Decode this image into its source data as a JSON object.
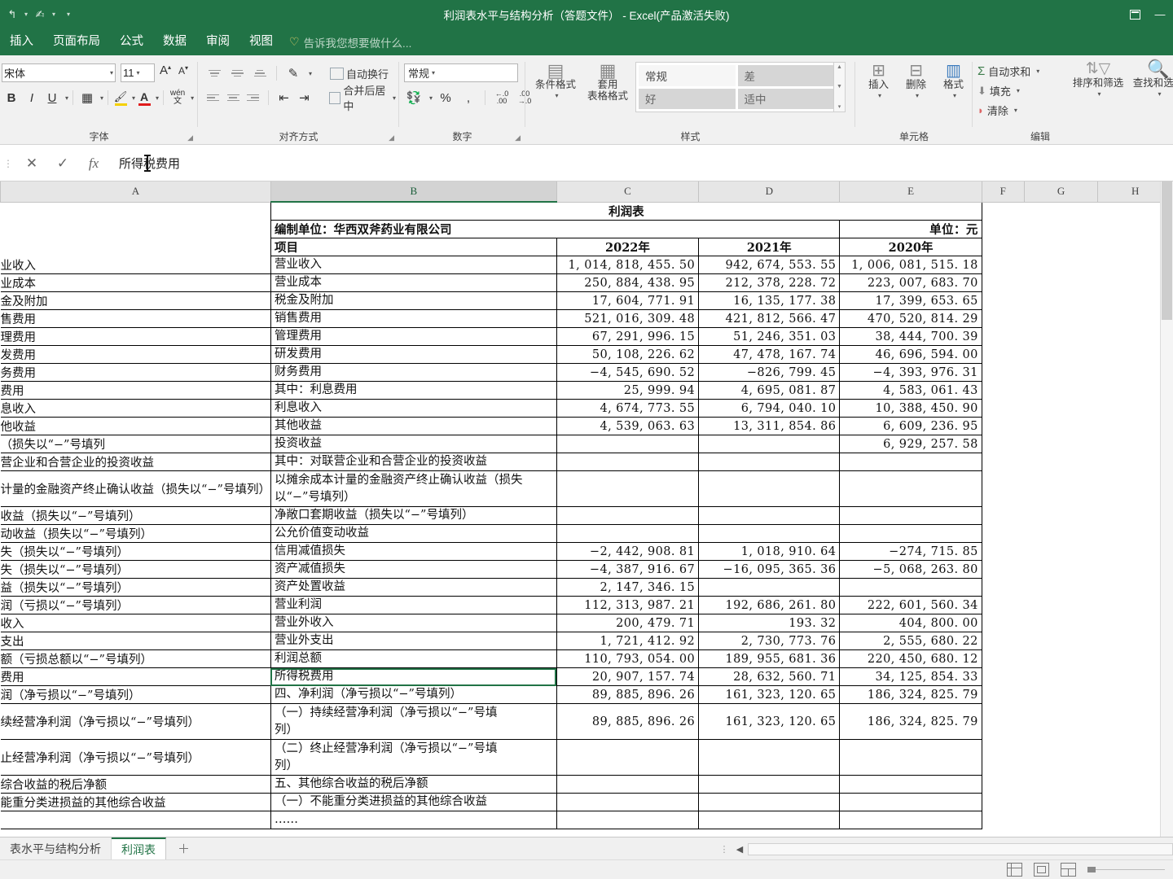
{
  "window": {
    "title": "利润表水平与结构分析（答题文件） - Excel(产品激活失败)",
    "quick_access": [
      "save-icon",
      "undo-icon",
      "redo-icon",
      "customize-icon"
    ],
    "restore_label": "□",
    "minimize_label": "—"
  },
  "ribbon": {
    "tabs": [
      "插入",
      "页面布局",
      "公式",
      "数据",
      "审阅",
      "视图"
    ],
    "tellme": "告诉我您想要做什么...",
    "groups": {
      "font": {
        "label": "字体",
        "font_name": "宋体",
        "font_size": "11",
        "grow": "A",
        "shrink": "A",
        "bold": "B",
        "italic": "I",
        "underline": "U",
        "borders": "borders-icon",
        "fill": "fill-color-icon",
        "font_color": "font-color-icon",
        "phonetic": "wén 文"
      },
      "alignment": {
        "label": "对齐方式",
        "wrap_text": "自动换行",
        "merge_center": "合并后居中",
        "orientation": "orientation-icon"
      },
      "number": {
        "label": "数字",
        "format": "常规",
        "accounting": "accounting-icon",
        "percent": "%",
        "comma": ",",
        "inc_dec": "+.0 .00",
        "dec_dec": ".00 →.0"
      },
      "styles": {
        "label": "样式",
        "conditional": "条件格式",
        "table_format": "套用\n表格格式",
        "cell_styles": [
          "常规",
          "差",
          "好",
          "适中"
        ]
      },
      "cells": {
        "label": "单元格",
        "insert": "插入",
        "delete": "删除",
        "format": "格式"
      },
      "editing": {
        "label": "编辑",
        "autosum": "自动求和",
        "fill": "填充",
        "clear": "清除",
        "sort_filter": "排序和筛选",
        "find_select": "查找和选择"
      }
    }
  },
  "formula_bar": {
    "cancel": "✕",
    "accept": "✓",
    "fx": "fx",
    "value": "所得税费用"
  },
  "grid": {
    "column_headers": [
      "A",
      "B",
      "C",
      "D",
      "E",
      "F",
      "G",
      "H"
    ],
    "active_column": "B",
    "title": "利润表",
    "prepared_by": "编制单位：华西双斧药业有限公司",
    "unit": "单位：元",
    "header_row": [
      "项目",
      "2022年",
      "2021年",
      "2020年"
    ],
    "rows": [
      {
        "a": "业收入",
        "b": "营业收入",
        "c": "1, 014, 818, 455. 50",
        "d": "942, 674, 553. 55",
        "e": "1, 006, 081, 515. 18"
      },
      {
        "a": "业成本",
        "b": "营业成本",
        "c": "250, 884, 438. 95",
        "d": "212, 378, 228. 72",
        "e": "223, 007, 683. 70"
      },
      {
        "a": "金及附加",
        "b": "税金及附加",
        "c": "17, 604, 771. 91",
        "d": "16, 135, 177. 38",
        "e": "17, 399, 653. 65"
      },
      {
        "a": "售费用",
        "b": "销售费用",
        "c": "521, 016, 309. 48",
        "d": "421, 812, 566. 47",
        "e": "470, 520, 814. 29"
      },
      {
        "a": "理费用",
        "b": "管理费用",
        "c": "67, 291, 996. 15",
        "d": "51, 246, 351. 03",
        "e": "38, 444, 700. 39"
      },
      {
        "a": "发费用",
        "b": "研发费用",
        "c": "50, 108, 226. 62",
        "d": "47, 478, 167. 74",
        "e": "46, 696, 594. 00"
      },
      {
        "a": "务费用",
        "b": "财务费用",
        "c": "−4, 545, 690. 52",
        "d": "−826, 799. 45",
        "e": "−4, 393, 976. 31"
      },
      {
        "a": "费用",
        "b": "其中：利息费用",
        "c": "25, 999. 94",
        "d": "4, 695, 081. 87",
        "e": "4, 583, 061. 43"
      },
      {
        "a": "息收入",
        "b": "利息收入",
        "c": "4, 674, 773. 55",
        "d": "6, 794, 040.  10",
        "e": "10, 388, 450. 90"
      },
      {
        "a": "他收益",
        "b": "其他收益",
        "c": "4, 539, 063. 63",
        "d": "13, 311, 854. 86",
        "e": "6, 609, 236. 95"
      },
      {
        "a": "损失以“−”号填列）",
        "b": "投资收益",
        "c": "",
        "d": "",
        "e": "6, 929, 257. 58"
      },
      {
        "a": "营企业和合营企业的投资收益",
        "b": "其中：对联营企业和合营企业的投资收益",
        "c": "",
        "d": "",
        "e": ""
      },
      {
        "a": "计量的金融资产终止确认收益（损失以“−”号填列）",
        "b": "以摊余成本计量的金融资产终止确认收益（损失以“−”号填列）",
        "c": "",
        "d": "",
        "e": ""
      },
      {
        "a": "收益（损失以“−”号填列）",
        "b": "净敞口套期收益（损失以“−”号填列）",
        "c": "",
        "d": "",
        "e": ""
      },
      {
        "a": "动收益（损失以“−”号填列）",
        "b": "公允价值变动收益",
        "c": "",
        "d": "",
        "e": ""
      },
      {
        "a": "失（损失以“−”号填列）",
        "b": "信用减值损失",
        "c": "−2, 442, 908. 81",
        "d": "1, 018, 910. 64",
        "e": "−274, 715. 85"
      },
      {
        "a": "失（损失以“−”号填列）",
        "b": "资产减值损失",
        "c": "−4, 387, 916. 67",
        "d": "−16, 095, 365. 36",
        "e": "−5, 068, 263. 80"
      },
      {
        "a": "益（损失以“−”号填列）",
        "b": "资产处置收益",
        "c": "2, 147, 346. 15",
        "d": "",
        "e": ""
      },
      {
        "a": "润（亏损以“−”号填列）",
        "b": "营业利润",
        "c": "112, 313, 987. 21",
        "d": "192, 686, 261. 80",
        "e": "222, 601, 560. 34"
      },
      {
        "a": "收入",
        "b": "营业外收入",
        "c": "200, 479. 71",
        "d": "193. 32",
        "e": "404, 800. 00"
      },
      {
        "a": "支出",
        "b": "营业外支出",
        "c": "1, 721, 412. 92",
        "d": "2, 730, 773. 76",
        "e": "2, 555, 680. 22"
      },
      {
        "a": "额（亏损总额以“−”号填列）",
        "b": "利润总额",
        "c": "110, 793, 054. 00",
        "d": "189, 955, 681. 36",
        "e": "220, 450, 680. 12"
      },
      {
        "a": "费用",
        "b": "所得税费用",
        "c": "20, 907, 157. 74",
        "d": "28, 632, 560. 71",
        "e": "34, 125, 854. 33"
      },
      {
        "a": "润（净亏损以“−”号填列）",
        "b": "四、净利润（净亏损以“−”号填列）",
        "c": "89, 885, 896. 26",
        "d": "161, 323, 120. 65",
        "e": "186, 324, 825. 79"
      },
      {
        "a": "续经营净利润（净亏损以“−”号填列）",
        "b": "（一）持续经营净利润（净亏损以“−”号填\n列）",
        "c": "89, 885, 896. 26",
        "d": "161, 323, 120. 65",
        "e": "186, 324, 825. 79"
      },
      {
        "a": "止经营净利润（净亏损以“−”号填列）",
        "b": "（二）终止经营净利润（净亏损以“−”号填\n列）",
        "c": "",
        "d": "",
        "e": ""
      },
      {
        "a": "综合收益的税后净额",
        "b": "五、其他综合收益的税后净额",
        "c": "",
        "d": "",
        "e": ""
      },
      {
        "a": "能重分类进损益的其他综合收益",
        "b": "（一）不能重分类进损益的其他综合收益",
        "c": "",
        "d": "",
        "e": ""
      },
      {
        "a": "",
        "b": "……",
        "c": "",
        "d": "",
        "e": ""
      }
    ],
    "selected_cell_label": "所得税费用"
  },
  "sheet_tabs": {
    "items": [
      {
        "label": "表水平与结构分析",
        "active": false
      },
      {
        "label": "利润表",
        "active": true
      }
    ],
    "add_label": "＋"
  },
  "status_bar": {
    "views": [
      "normal-view-icon",
      "page-layout-icon",
      "page-break-icon"
    ],
    "zoom_minus": "—"
  }
}
